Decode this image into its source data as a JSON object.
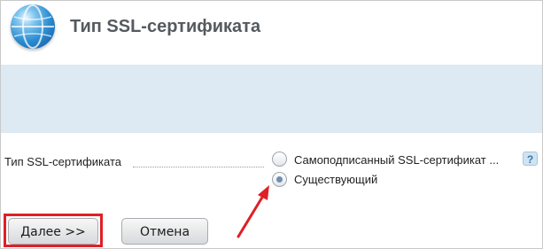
{
  "header": {
    "title": "Тип SSL-сертификата",
    "icon": "globe-icon"
  },
  "form": {
    "field_label": "Тип SSL-сертификата",
    "options": [
      {
        "label": "Самоподписанный SSL-сертификат ...",
        "selected": false
      },
      {
        "label": "Существующий",
        "selected": true
      }
    ],
    "help_label": "?"
  },
  "buttons": {
    "next_label": "Далее >>",
    "cancel_label": "Отмена"
  },
  "annotation": {
    "highlight_color": "#e01f26",
    "arrow_color": "#e01f26"
  }
}
